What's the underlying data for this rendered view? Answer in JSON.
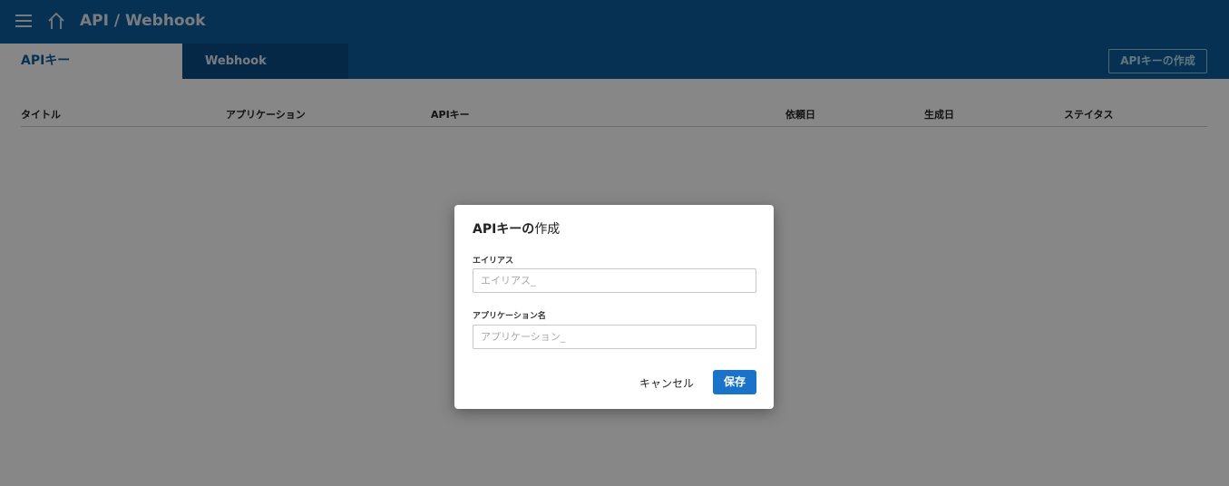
{
  "header": {
    "title": "API / Webhook",
    "menu_icon": "hamburger-menu-icon",
    "home_icon": "home-icon",
    "bg_color": "#0e5e9e"
  },
  "tabs": [
    {
      "label": "APIキー",
      "active": true
    },
    {
      "label": "Webhook",
      "active": false
    }
  ],
  "toolbar": {
    "create_label": "APIキーの作成"
  },
  "table": {
    "columns": [
      "タイトル",
      "アプリケーション",
      "APIキー",
      "依頼日",
      "生成日",
      "ステイタス"
    ],
    "rows": []
  },
  "modal": {
    "title_bold": "APIキーの",
    "title_rest": "作成",
    "alias": {
      "label": "エイリアス",
      "placeholder": "エイリアス_"
    },
    "app_name": {
      "label": "アプリケーション名",
      "placeholder": "アプリケーション_"
    },
    "cancel_label": "キャンセル",
    "save_label": "保存",
    "accent_color": "#1a73c8"
  }
}
